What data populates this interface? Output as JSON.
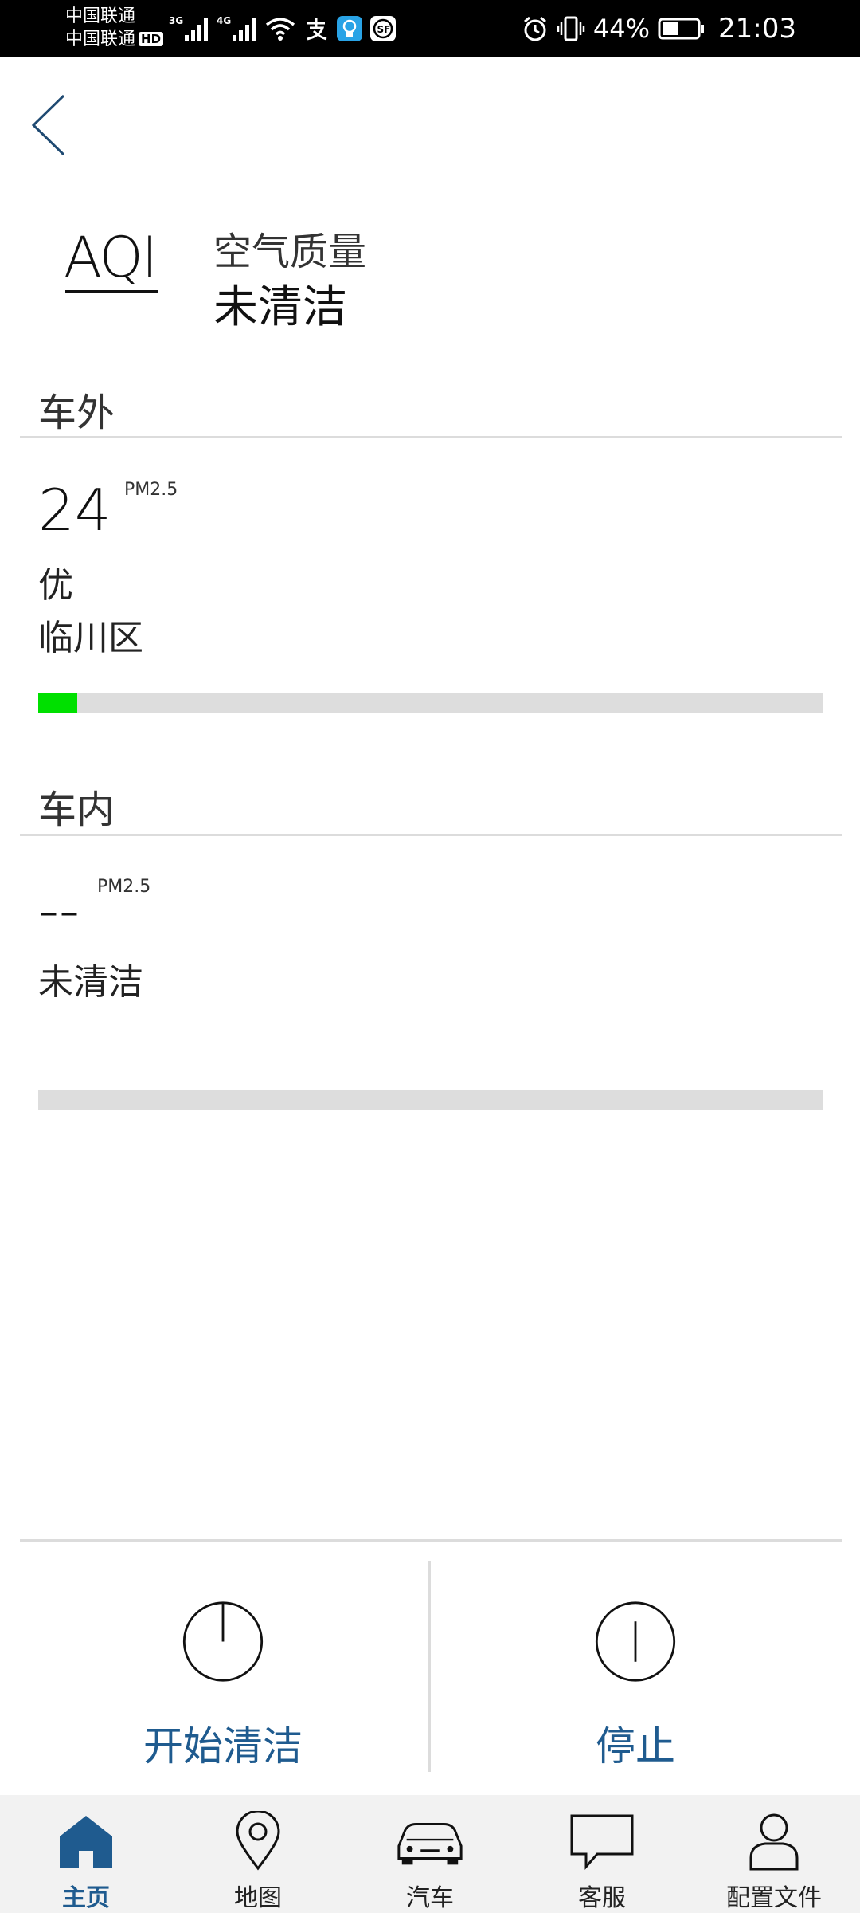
{
  "status_bar": {
    "carrier1": "中国联通",
    "carrier2": "中国联通",
    "hd": "HD",
    "net1": "3G",
    "net2": "4G",
    "battery_pct": "44%",
    "time": "21:03"
  },
  "header": {
    "logo_text": "AQI",
    "subtitle": "空气质量",
    "title": "未清洁"
  },
  "outside": {
    "section_title": "车外",
    "value": "24",
    "unit": "PM2.5",
    "quality": "优",
    "location": "临川区",
    "level": 0.05,
    "level_color": "#00e000"
  },
  "inside": {
    "section_title": "车内",
    "value": "--",
    "unit": "PM2.5",
    "status": "未清洁",
    "level": 0
  },
  "actions": {
    "start_label": "开始清洁",
    "stop_label": "停止"
  },
  "tabs": [
    {
      "label": "主页",
      "icon": "home-icon",
      "active": true
    },
    {
      "label": "地图",
      "icon": "map-pin-icon",
      "active": false
    },
    {
      "label": "汽车",
      "icon": "car-icon",
      "active": false
    },
    {
      "label": "客服",
      "icon": "chat-icon",
      "active": false
    },
    {
      "label": "配置文件",
      "icon": "profile-icon",
      "active": false
    }
  ],
  "colors": {
    "accent": "#1f5b8f",
    "track": "#dddddd"
  }
}
